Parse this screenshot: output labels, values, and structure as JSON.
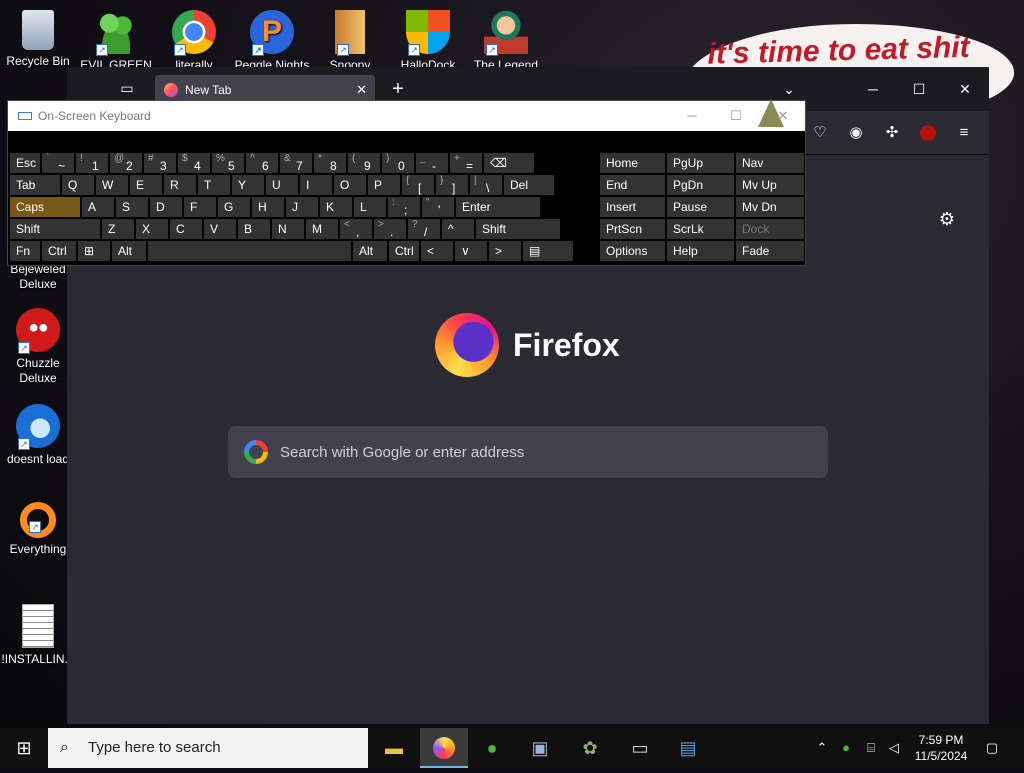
{
  "desktop": {
    "icons": [
      {
        "label": "Recycle Bin"
      },
      {
        "label": "EVIL GREEN"
      },
      {
        "label": "literally"
      },
      {
        "label": "Peggle Nights"
      },
      {
        "label": "Snoopy"
      },
      {
        "label": "HalloDock"
      },
      {
        "label": "The Legend"
      },
      {
        "label": "Bejeweled Deluxe"
      },
      {
        "label": "Chuzzle Deluxe"
      },
      {
        "label": "doesnt load"
      },
      {
        "label": "Everything"
      },
      {
        "label": "!INSTALLIN..."
      }
    ],
    "banner_text": "it's time to eat shit"
  },
  "firefox": {
    "tab_title": "New Tab",
    "brand": "Firefox",
    "search_placeholder": "Search with Google or enter address"
  },
  "osk": {
    "title": "On-Screen Keyboard",
    "rows": [
      [
        {
          "t": "Esc"
        },
        {
          "t": "~",
          "s": "`"
        },
        {
          "t": "1",
          "s": "!"
        },
        {
          "t": "2",
          "s": "@"
        },
        {
          "t": "3",
          "s": "#"
        },
        {
          "t": "4",
          "s": "$"
        },
        {
          "t": "5",
          "s": "%"
        },
        {
          "t": "6",
          "s": "^"
        },
        {
          "t": "7",
          "s": "&"
        },
        {
          "t": "8",
          "s": "*"
        },
        {
          "t": "9",
          "s": "("
        },
        {
          "t": "0",
          "s": ")"
        },
        {
          "t": "-",
          "s": "_"
        },
        {
          "t": "=",
          "s": "+"
        },
        {
          "t": "⌫"
        }
      ],
      [
        {
          "t": "Tab"
        },
        {
          "t": "Q"
        },
        {
          "t": "W"
        },
        {
          "t": "E"
        },
        {
          "t": "R"
        },
        {
          "t": "T"
        },
        {
          "t": "Y"
        },
        {
          "t": "U"
        },
        {
          "t": "I"
        },
        {
          "t": "O"
        },
        {
          "t": "P"
        },
        {
          "t": "[",
          "s": "{"
        },
        {
          "t": "]",
          "s": "}"
        },
        {
          "t": "\\",
          "s": "|"
        },
        {
          "t": "Del"
        }
      ],
      [
        {
          "t": "Caps"
        },
        {
          "t": "A"
        },
        {
          "t": "S"
        },
        {
          "t": "D"
        },
        {
          "t": "F"
        },
        {
          "t": "G"
        },
        {
          "t": "H"
        },
        {
          "t": "J"
        },
        {
          "t": "K"
        },
        {
          "t": "L"
        },
        {
          "t": ";",
          "s": ":"
        },
        {
          "t": "'",
          "s": "\""
        },
        {
          "t": "Enter"
        }
      ],
      [
        {
          "t": "Shift"
        },
        {
          "t": "Z"
        },
        {
          "t": "X"
        },
        {
          "t": "C"
        },
        {
          "t": "V"
        },
        {
          "t": "B"
        },
        {
          "t": "N"
        },
        {
          "t": "M"
        },
        {
          "t": ",",
          "s": "<"
        },
        {
          "t": ".",
          "s": ">"
        },
        {
          "t": "/",
          "s": "?"
        },
        {
          "t": "^"
        },
        {
          "t": "Shift"
        }
      ],
      [
        {
          "t": "Fn"
        },
        {
          "t": "Ctrl"
        },
        {
          "t": "⊞"
        },
        {
          "t": "Alt"
        },
        {
          "t": ""
        },
        {
          "t": "Alt"
        },
        {
          "t": "Ctrl"
        },
        {
          "t": "<"
        },
        {
          "t": "∨"
        },
        {
          "t": ">"
        },
        {
          "t": "▤"
        }
      ]
    ],
    "side": [
      [
        "Home",
        "PgUp",
        "Nav"
      ],
      [
        "End",
        "PgDn",
        "Mv Up"
      ],
      [
        "Insert",
        "Pause",
        "Mv Dn"
      ],
      [
        "PrtScn",
        "ScrLk",
        "Dock"
      ],
      [
        "Options",
        "Help",
        "Fade"
      ]
    ]
  },
  "taskbar": {
    "search_placeholder": "Type here to search",
    "time": "7:59 PM",
    "date": "11/5/2024"
  }
}
